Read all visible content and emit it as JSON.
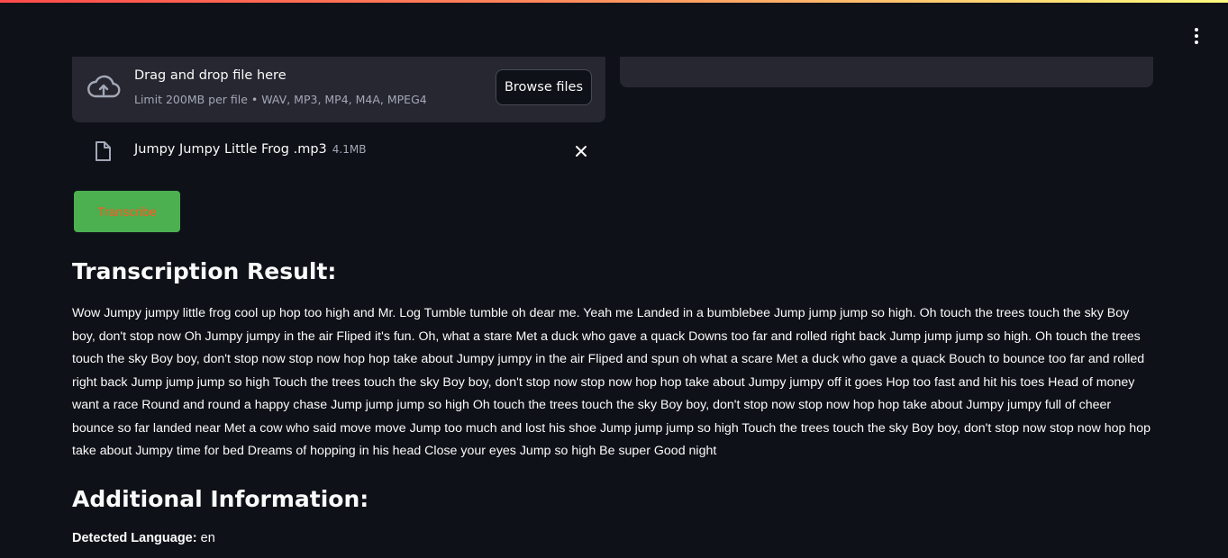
{
  "uploader": {
    "title": "Drag and drop file here",
    "limit": "Limit 200MB per file • WAV, MP3, MP4, M4A, MPEG4",
    "browse_label": "Browse files",
    "icon": "cloud-upload-icon"
  },
  "uploaded_file": {
    "name": "Jumpy Jumpy Little Frog .mp3",
    "size": "4.1MB",
    "icon": "file-icon",
    "remove_icon": "close-icon"
  },
  "actions": {
    "transcribe_label": "Transcribe"
  },
  "result": {
    "heading": "Transcription Result:",
    "text": "Wow Jumpy jumpy little frog cool up hop too high and Mr. Log Tumble tumble oh dear me. Yeah me Landed in a bumblebee Jump jump jump so high. Oh touch the trees touch the sky Boy boy, don't stop now Oh Jumpy jumpy in the air Fliped it's fun. Oh, what a stare Met a duck who gave a quack Downs too far and rolled right back Jump jump jump so high. Oh touch the trees touch the sky Boy boy, don't stop now stop now hop hop take about Jumpy jumpy in the air Fliped and spun oh what a scare Met a duck who gave a quack Bouch to bounce too far and rolled right back Jump jump jump so high Touch the trees touch the sky Boy boy, don't stop now stop now hop hop take about Jumpy jumpy off it goes Hop too fast and hit his toes Head of money want a race Round and round a happy chase Jump jump jump so high Oh touch the trees touch the sky Boy boy, don't stop now stop now hop hop take about Jumpy jumpy full of cheer bounce so far landed near Met a cow who said move move Jump too much and lost his shoe Jump jump jump so high Touch the trees touch the sky Boy boy, don't stop now stop now hop hop take about Jumpy time for bed Dreams of hopping in his head Close your eyes Jump so high Be super Good night"
  },
  "info": {
    "heading": "Additional Information:",
    "language_label": "Detected Language:",
    "language_value": "en"
  },
  "menu": {
    "icon": "more-vertical-icon"
  },
  "colors": {
    "background": "#0e1117",
    "panel": "#262730",
    "button_green": "#4caf50",
    "button_text": "#ff5722"
  }
}
